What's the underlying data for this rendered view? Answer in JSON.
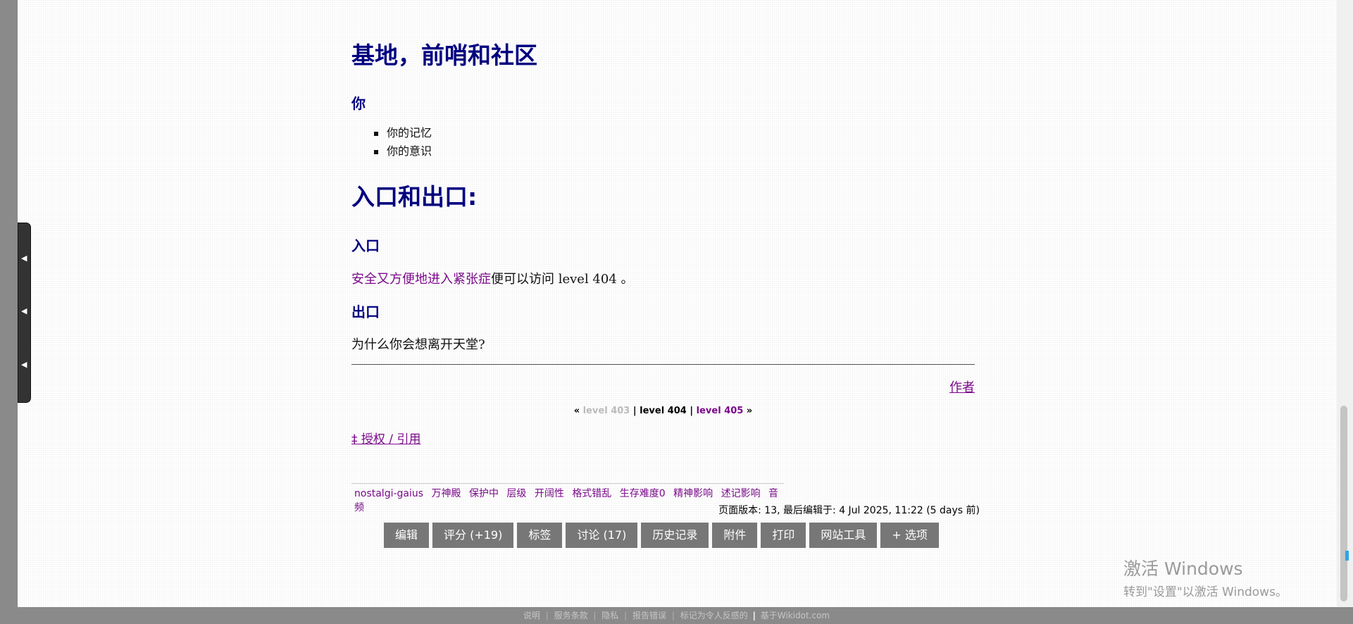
{
  "content": {
    "heading_bases": "基地，前哨和社区",
    "heading_you": "你",
    "list_items": [
      "你的记忆",
      "你的意识"
    ],
    "heading_entrances_exits": "入口和出口:",
    "heading_entrances": "入口",
    "entrance_link": "安全又方便地进入紧张症",
    "entrance_text": "便可以访问 level 404 。",
    "heading_exits": "出口",
    "exit_text": "为什么你会想离开天堂?",
    "author_link": "作者"
  },
  "navigation": {
    "left_quote": "«",
    "prev": "level 403",
    "sep1": "|",
    "current": "level 404",
    "sep2": "|",
    "next": "level 405",
    "right_quote": "»"
  },
  "license": {
    "label": "‡ 授权 / 引用"
  },
  "tags": [
    "nostalgi-gaius",
    "万神殿",
    "保护中",
    "层级",
    "开阔性",
    "格式错乱",
    "生存难度0",
    "精神影响",
    "述记影响",
    "音频"
  ],
  "page_info": "页面版本: 13, 最后编辑于: 4 Jul 2025, 11:22 (5 days 前)",
  "buttons": [
    "编辑",
    "评分 (+19)",
    "标签",
    "讨论 (17)",
    "历史记录",
    "附件",
    "打印",
    "网站工具",
    "+ 选项"
  ],
  "watermark": {
    "line1": "激活 Windows",
    "line2": "转到\"设置\"以激活 Windows。"
  },
  "footer": {
    "links": [
      "说明",
      "服务条款",
      "隐私",
      "报告错误",
      "标记为令人反感的"
    ],
    "sep": "|",
    "powered": "基于Wikidot.com"
  },
  "side_tab_icons": [
    "arrow-left-icon",
    "arrow-left-icon",
    "arrow-left-icon"
  ]
}
